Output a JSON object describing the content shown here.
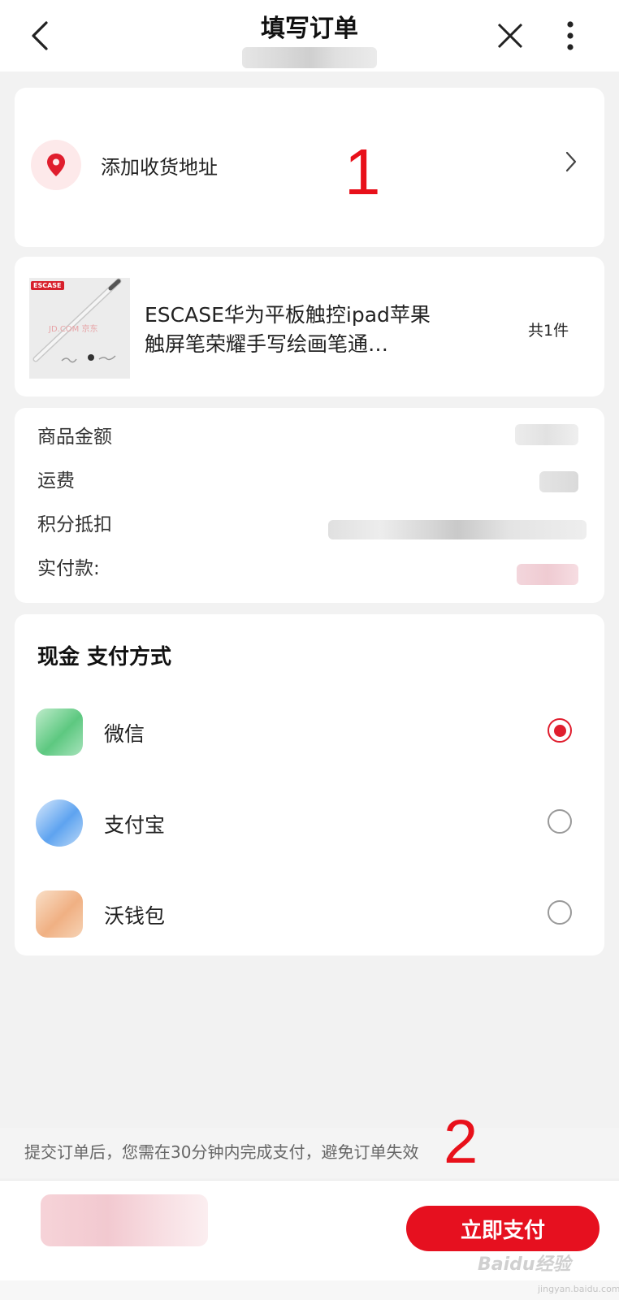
{
  "header": {
    "title": "填写订单",
    "back_icon": "back-arrow-icon",
    "close_icon": "close-icon",
    "more_icon": "more-vertical-icon"
  },
  "address": {
    "label": "添加收货地址",
    "icon": "location-pin-icon"
  },
  "annotations": {
    "first": "1",
    "second": "2"
  },
  "product": {
    "brand_tag": "ESCASE",
    "watermark": "JD.COM 京东",
    "name": "ESCASE华为平板触控ipad苹果触屏笔荣耀手写绘画笔通…",
    "count": "共1件"
  },
  "summary": {
    "items": [
      {
        "label": "商品金额"
      },
      {
        "label": "运费"
      },
      {
        "label": "积分抵扣"
      },
      {
        "label": "实付款:"
      }
    ]
  },
  "payment": {
    "heading": "现金 支付方式",
    "methods": [
      {
        "label": "微信",
        "selected": true,
        "color": "#5dc880"
      },
      {
        "label": "支付宝",
        "selected": false,
        "color": "#5ea3f0"
      },
      {
        "label": "沃钱包",
        "selected": false,
        "color": "#f0b083"
      }
    ]
  },
  "notice": "提交订单后，您需在30分钟内完成支付，避免订单失效",
  "footer": {
    "pay_button": "立即支付"
  },
  "watermark": {
    "brand": "Baidu经验",
    "domain": "jingyan.baidu.com"
  },
  "colors": {
    "accent": "#e6101f",
    "background": "#f2f2f2"
  }
}
